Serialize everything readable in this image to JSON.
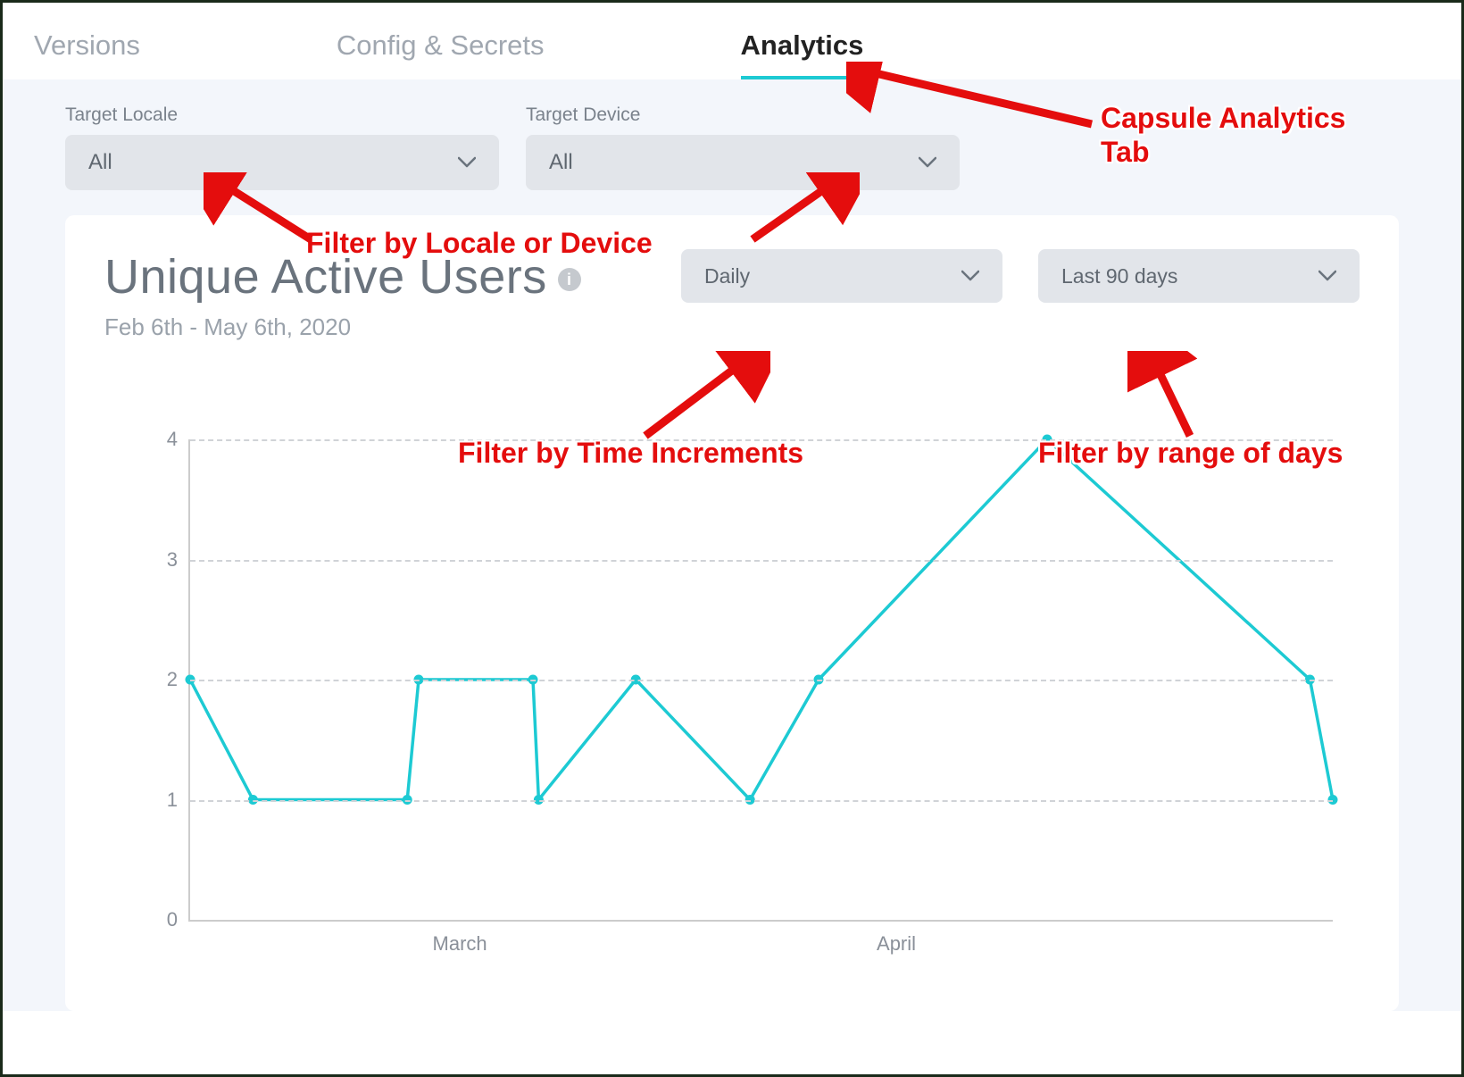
{
  "tabs": [
    {
      "label": "Versions"
    },
    {
      "label": "Config & Secrets"
    },
    {
      "label": "Analytics"
    }
  ],
  "active_tab_index": 2,
  "filters": {
    "locale": {
      "label": "Target Locale",
      "value": "All"
    },
    "device": {
      "label": "Target Device",
      "value": "All"
    }
  },
  "chart": {
    "title": "Unique Active Users",
    "subtitle": "Feb 6th - May 6th, 2020",
    "increment_select": "Daily",
    "range_select": "Last 90 days"
  },
  "annotations": {
    "tab": "Capsule Analytics Tab",
    "locale_device": "Filter by Locale or Device",
    "increments": "Filter by Time Increments",
    "range": "Filter by range of days"
  },
  "chart_data": {
    "type": "line",
    "title": "Unique Active Users",
    "xlabel": "",
    "ylabel": "",
    "ylim": [
      0,
      4
    ],
    "y_ticks": [
      0,
      1,
      2,
      3,
      4
    ],
    "x_tick_labels": [
      "March",
      "April"
    ],
    "x_tick_positions": [
      0.236,
      0.618
    ],
    "series": [
      {
        "name": "Unique Active Users",
        "color": "#1dcad3",
        "x": [
          0.0,
          0.055,
          0.19,
          0.2,
          0.3,
          0.305,
          0.39,
          0.49,
          0.55,
          0.75,
          0.98,
          1.0
        ],
        "values": [
          2,
          1,
          1,
          2,
          2,
          1,
          2,
          1,
          2,
          4,
          2,
          1
        ]
      }
    ]
  }
}
